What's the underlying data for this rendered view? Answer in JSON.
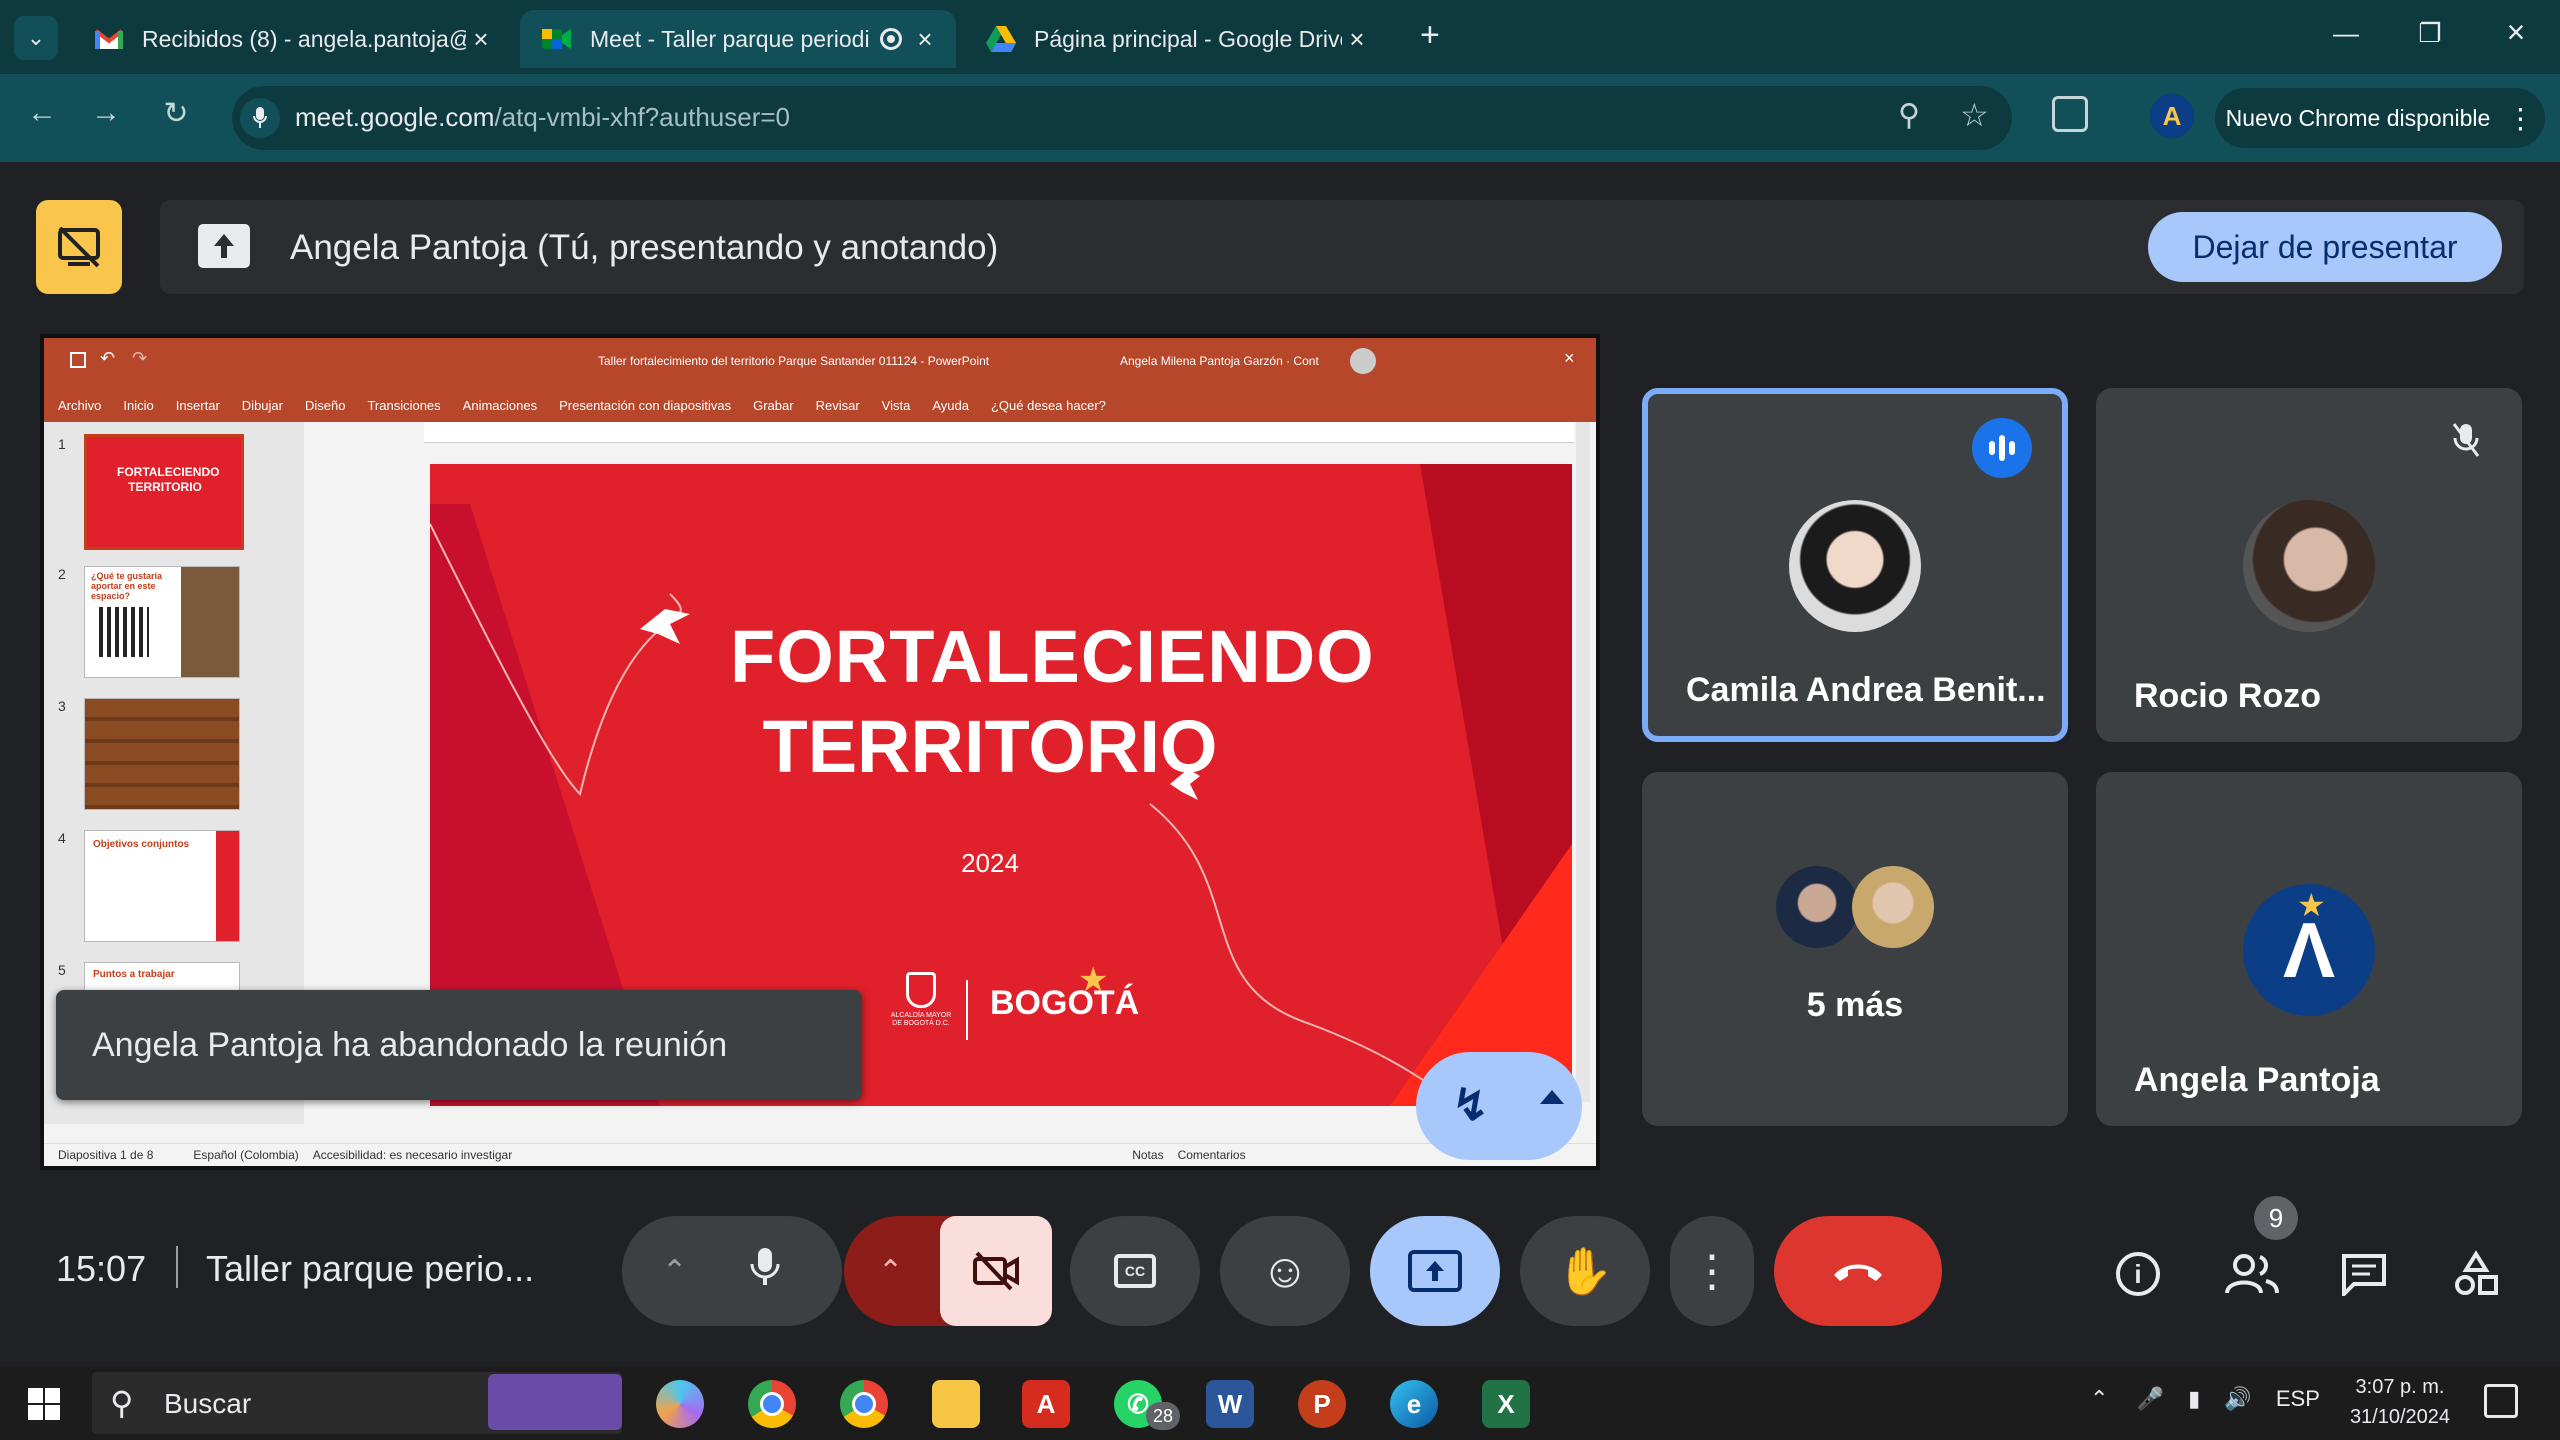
{
  "browser": {
    "tabs": [
      {
        "title": "Recibidos (8) - angela.pantoja@",
        "icon": "gmail-icon",
        "active": false
      },
      {
        "title": "Meet - Taller parque periodi",
        "icon": "meet-icon",
        "active": true
      },
      {
        "title": "Página principal - Google Drive",
        "icon": "drive-icon",
        "active": false
      }
    ],
    "url_host": "meet.google.com",
    "url_path": "/atq-vmbi-xhf?authuser=0",
    "update_label": "Nuevo Chrome disponible"
  },
  "presenting": {
    "label": "Angela Pantoja (Tú, presentando y anotando)",
    "stop_button": "Dejar de presentar"
  },
  "shared_screen": {
    "ppt_title": "Taller fortalecimiento del territorio Parque Santander 011124 - PowerPoint",
    "ppt_user": "Angela Milena Pantoja Garzón · Cont",
    "ribbon_tabs": [
      "Archivo",
      "Inicio",
      "Insertar",
      "Dibujar",
      "Diseño",
      "Transiciones",
      "Animaciones",
      "Presentación con diapositivas",
      "Grabar",
      "Revisar",
      "Vista",
      "Ayuda",
      "¿Qué desea hacer?"
    ],
    "thumbnails": [
      {
        "num": "1",
        "text": "FORTALECIENDO TERRITORIO"
      },
      {
        "num": "2",
        "text": "¿Qué te gustaría aportar en este espacio?"
      },
      {
        "num": "3",
        "text": ""
      },
      {
        "num": "4",
        "text": "Objetivos conjuntos"
      },
      {
        "num": "5",
        "text": "Puntos a trabajar"
      }
    ],
    "slide": {
      "line1": "FORTALECIENDO",
      "line2": "TERRITORIO",
      "year": "2024",
      "logo_text": "BOGOTÁ",
      "seal_text": "ALCALDÍA MAYOR DE BOGOTÁ D.C."
    },
    "status": {
      "slide_count": "Diapositiva 1 de 8",
      "language": "Español (Colombia)",
      "accessibility": "Accesibilidad: es necesario investigar",
      "notes": "Notas",
      "comments": "Comentarios"
    }
  },
  "toast": "Angela Pantoja ha abandonado la reunión",
  "participants": [
    {
      "name": "Camila Andrea Benit...",
      "state": "speaking"
    },
    {
      "name": "Rocio Rozo",
      "state": "muted"
    },
    {
      "name": "5 más",
      "state": "group"
    },
    {
      "name": "Angela Pantoja",
      "state": "self"
    }
  ],
  "bottom_bar": {
    "time": "15:07",
    "meeting_name": "Taller parque perio...",
    "people_badge": "9"
  },
  "taskbar": {
    "search_placeholder": "Buscar",
    "whatsapp_badge": "28",
    "lang": "ESP",
    "time": "3:07 p. m.",
    "date": "31/10/2024"
  },
  "colors": {
    "chrome_dark": "#0d3a3f",
    "chrome_mid": "#115058",
    "meet_bg": "#202124",
    "tile_bg": "#3c4043",
    "accent_blue": "#a8c7fa",
    "end_call_red": "#dc362e",
    "slide_red": "#e0202a"
  }
}
